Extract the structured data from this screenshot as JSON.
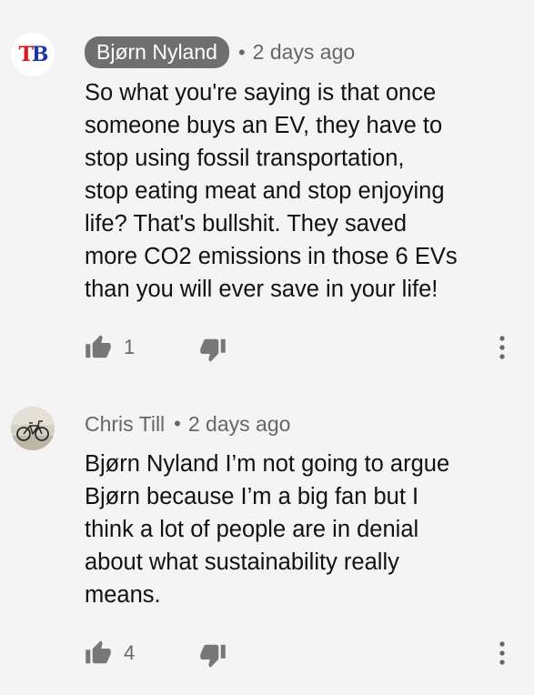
{
  "comments": [
    {
      "author": "Bjørn Nyland",
      "author_style": "highlighted-chip",
      "avatar": {
        "icon": "tb-logo",
        "letters": "TB"
      },
      "separator": "•",
      "time": "2 days ago",
      "text": "So what you're saying is that once\nsomeone buys an EV, they have to\nstop using fossil transportation,\nstop eating meat and stop enjoying\nlife? That's bullshit. They saved\nmore CO2 emissions in those 6 EVs\nthan you will ever save in your life!",
      "likes": "1",
      "icons": {
        "like": "thumbs-up-icon",
        "dislike": "thumbs-down-icon",
        "menu": "more-vert-icon"
      }
    },
    {
      "author": "Chris Till",
      "author_style": "plain",
      "avatar": {
        "icon": "bicycle-photo"
      },
      "separator": "•",
      "time": "2 days ago",
      "text": "Bjørn Nyland I’m not going to argue\nBjørn because I’m a big fan but I\nthink a lot of people are in denial\nabout what sustainability really\nmeans.",
      "likes": "4",
      "icons": {
        "like": "thumbs-up-icon",
        "dislike": "thumbs-down-icon",
        "menu": "more-vert-icon"
      }
    }
  ],
  "colors": {
    "background": "#f4f4f4",
    "chip": "#6f6f6f",
    "meta_text": "#666666",
    "body_text": "#111111",
    "icon": "#777777",
    "logo_red": "#e0151b",
    "logo_blue": "#1c36a8"
  }
}
